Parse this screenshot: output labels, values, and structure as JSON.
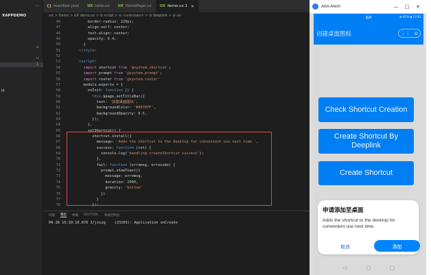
{
  "ide": {
    "sidebar": {
      "project": "XAPPDEMO",
      "more": "···"
    },
    "tabs": [
      {
        "icon": "{}",
        "label": "manifest.json",
        "type": "json"
      },
      {
        "icon": "UX",
        "label": "hello.ux",
        "type": "ux"
      },
      {
        "icon": "UX",
        "label": "HomePage.ux",
        "type": "ux"
      },
      {
        "icon": "UX",
        "label": "demo.ux 1",
        "type": "ux",
        "active": true
      }
    ],
    "breadcrumb": "src > Demo > UX demo.ux > ⊘ script > ⊖ <unknown> > ⊘ deeplink > ⊘ uri",
    "code_lines": [
      {
        "n": "46",
        "html": "          border-radius: 220px;"
      },
      {
        "n": "47",
        "html": "          align-self: center;"
      },
      {
        "n": "48",
        "html": "          text-align: center;"
      },
      {
        "n": "49",
        "html": "          opacity: 0.4;"
      },
      {
        "n": "50",
        "html": "        }"
      },
      {
        "n": "51",
        "html": "      </style>"
      },
      {
        "n": "52",
        "html": ""
      },
      {
        "n": "53",
        "html": "      <script>"
      },
      {
        "n": "54",
        "html": "        import shortcut from '@system.shortcut';"
      },
      {
        "n": "55",
        "html": "        import prompt from '@system.prompt';"
      },
      {
        "n": "56",
        "html": "        import router from '@system.router'"
      },
      {
        "n": "57",
        "html": "        module.exports = {"
      },
      {
        "n": "58",
        "html": "          onInit: function () {"
      },
      {
        "n": "59",
        "html": "            this.$page.setTitleBar({"
      },
      {
        "n": "60",
        "html": "              text: '创建桌面图标',"
      },
      {
        "n": "61",
        "html": "              backgroundColor: '#007DFF',"
      },
      {
        "n": "62",
        "html": "              backgroundOpacity: 0.5,"
      },
      {
        "n": "63",
        "html": "            });"
      },
      {
        "n": "64",
        "html": "          },"
      },
      {
        "n": "65",
        "html": "          setShortcut() {"
      },
      {
        "n": "66",
        "html": "            shortcut.install({"
      },
      {
        "n": "67",
        "html": "              message: 'Adds the shortcut to the desktop for convenient use next time.',"
      },
      {
        "n": "68",
        "html": "              success: function (ret) {"
      },
      {
        "n": "69",
        "html": "                console.log('handling createShortcut success');"
      },
      {
        "n": "70",
        "html": "              },"
      },
      {
        "n": "71",
        "html": "              fail: function (erromsg, errocode) {"
      },
      {
        "n": "72",
        "html": "                prompt.showToast({"
      },
      {
        "n": "73",
        "html": "                  message: erromsg,"
      },
      {
        "n": "74",
        "html": "                  duration: 2000,"
      },
      {
        "n": "75",
        "html": "                  gravity: 'bottom'"
      },
      {
        "n": "76",
        "html": "                })"
      },
      {
        "n": "77",
        "html": "              }"
      },
      {
        "n": "78",
        "html": "            });"
      }
    ],
    "panel": {
      "tabs": [
        "问题",
        "输出",
        "终端",
        "DEVTOOL",
        "调试控制台"
      ],
      "active_tab": "输出",
      "log": "06-28 15:19:16.876 I/jsLog    (23103): Application onCreate"
    }
  },
  "emulator": {
    "window_title": "ANA-AN00",
    "window_controls": [
      "—",
      "□",
      "✕"
    ],
    "status_center": "监听",
    "status_right": "⊕ 87% ▮ 17:01",
    "page_title": "创建桌面图标",
    "capsule": [
      "⋮⋮",
      "⊙"
    ],
    "buttons": [
      "Check Shortcut Creation",
      "Create Shortcut By Deeplink",
      "Create Shortcut"
    ],
    "dialog": {
      "title": "申请添加至桌面",
      "message": "Adds the shortcut to the desktop for convenient use next time.",
      "cancel": "取消",
      "confirm": "添加"
    },
    "nav": [
      "◁",
      "○",
      "□"
    ]
  },
  "colors": {
    "accent": "#0085ff",
    "highlight_border": "#e04848"
  }
}
